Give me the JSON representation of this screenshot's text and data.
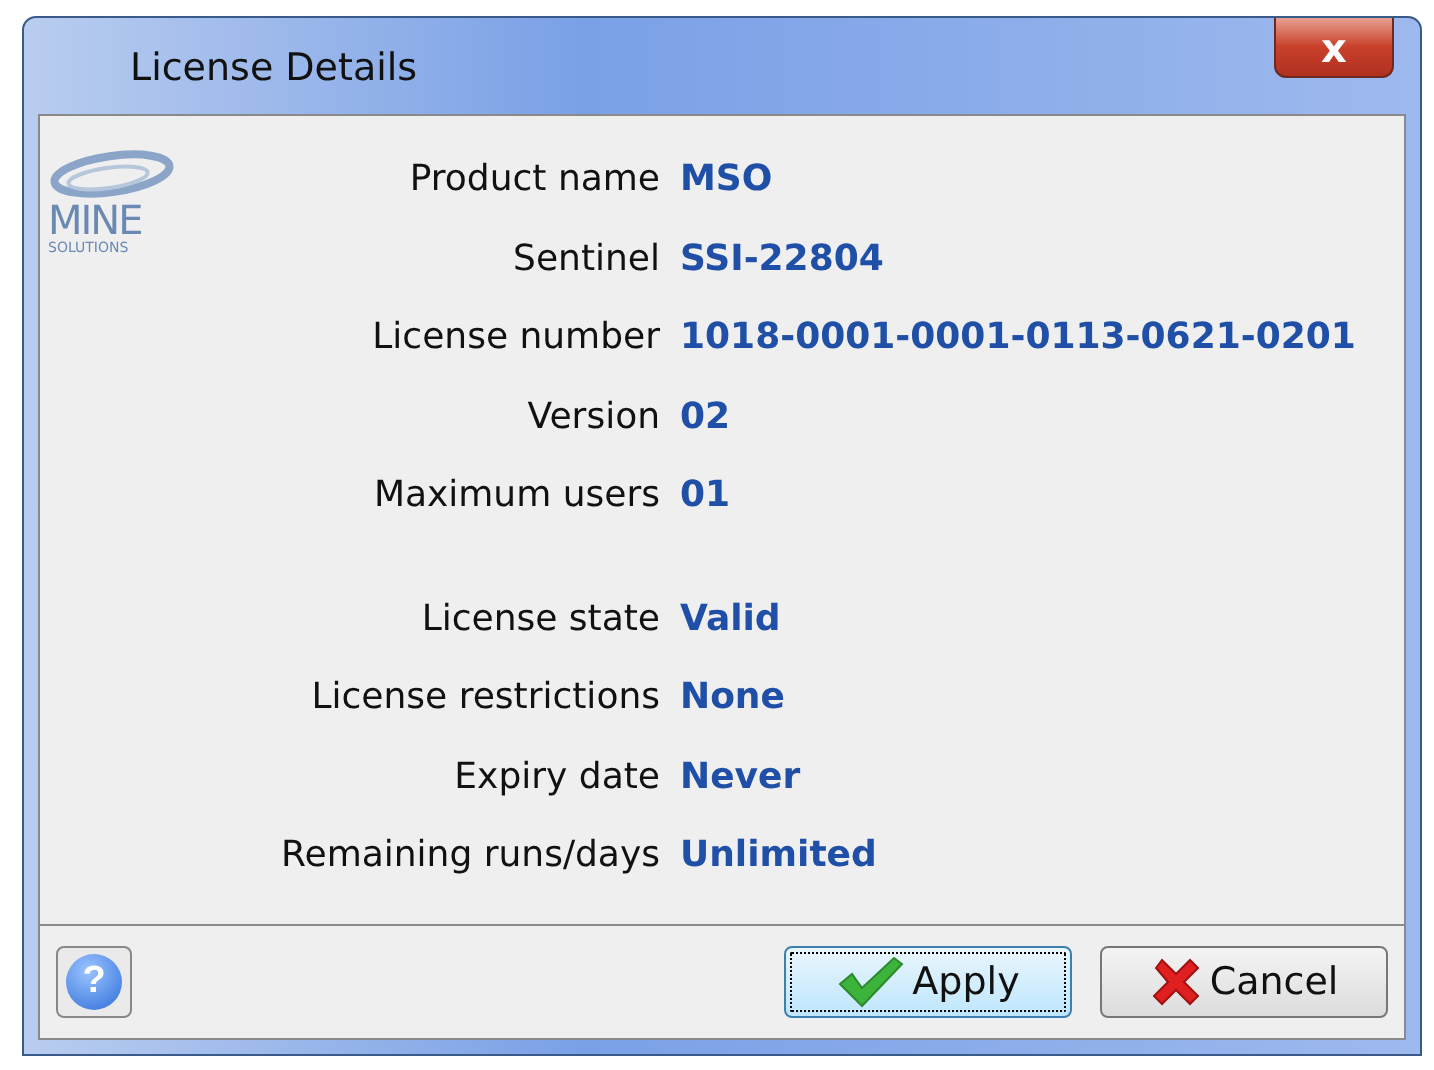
{
  "window": {
    "title": "License Details",
    "close": "x"
  },
  "logo": {
    "name": "MINE",
    "tagline": "SOLUTIONS"
  },
  "sections": [
    {
      "rows": [
        {
          "label": "Product name",
          "value": "MSO"
        },
        {
          "label": "Sentinel",
          "value": "SSI-22804"
        },
        {
          "label": "License number",
          "value": "1018-0001-0001-0113-0621-0201"
        },
        {
          "label": "Version",
          "value": "02"
        },
        {
          "label": "Maximum users",
          "value": "01"
        }
      ]
    },
    {
      "rows": [
        {
          "label": "License state",
          "value": "Valid"
        },
        {
          "label": "License restrictions",
          "value": "None"
        },
        {
          "label": "Expiry date",
          "value": "Never"
        },
        {
          "label": "Remaining runs/days",
          "value": "Unlimited"
        }
      ]
    }
  ],
  "help": "?",
  "buttons": [
    {
      "kind": "apply",
      "label": "Apply",
      "focused": true
    },
    {
      "kind": "cancel",
      "label": "Cancel",
      "focused": false
    }
  ]
}
